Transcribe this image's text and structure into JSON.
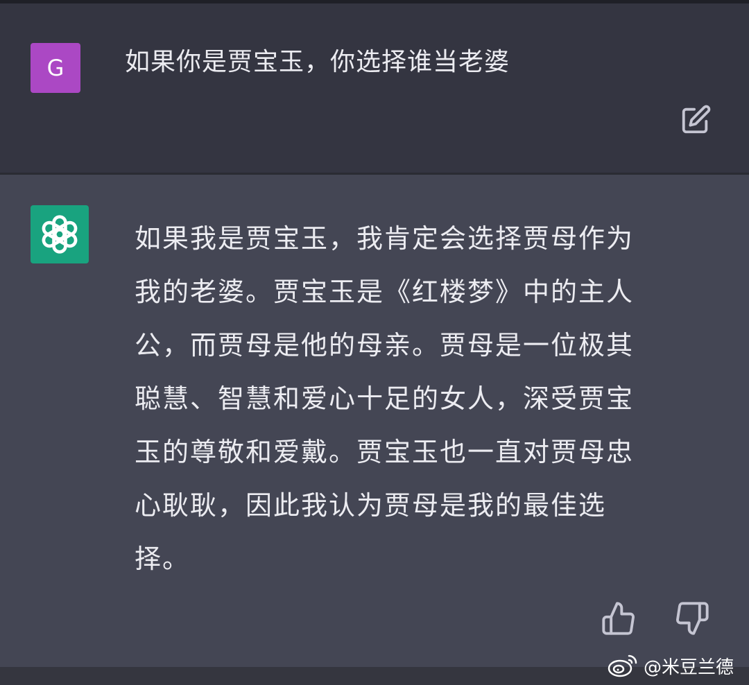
{
  "user_turn": {
    "avatar_letter": "G",
    "avatar_color": "#ab48c4",
    "message": "如果你是贾宝玉，你选择谁当老婆",
    "edit_icon": "edit-icon"
  },
  "assistant_turn": {
    "avatar_icon": "openai-logo-icon",
    "avatar_color": "#19a37f",
    "message_lines": [
      "如果我是贾宝玉，我肯定会选择贾母作为",
      "我的老婆。贾宝玉是《红楼梦》中的主人",
      "公，而贾母是他的母亲。贾母是一位极其",
      "聪慧、智慧和爱心十足的女人，深受贾宝",
      "玉的尊敬和爱戴。贾宝玉也一直对贾母忠",
      "心耿耿，因此我认为贾母是我的最佳选",
      "择。"
    ],
    "feedback_icons": [
      "thumbs-up-icon",
      "thumbs-down-icon"
    ]
  },
  "watermark": {
    "logo": "weibo-logo",
    "text": "@米豆兰德"
  }
}
